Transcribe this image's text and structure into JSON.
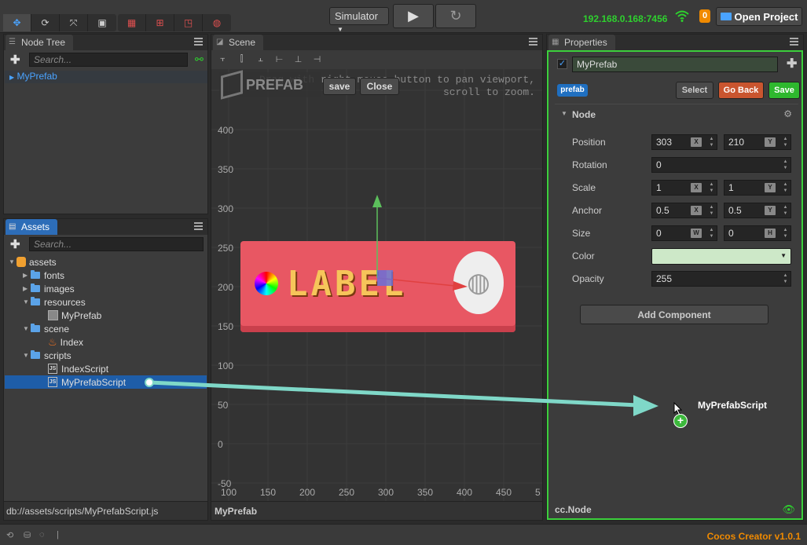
{
  "toolbar": {
    "transform_tools": [
      "move-tool-icon",
      "rotate-tool-icon",
      "scale-tool-icon",
      "rect-tool-icon"
    ],
    "gizmo_tools": [
      "pivot-icon",
      "global-icon",
      "flag-icon",
      "globe-icon"
    ],
    "simulator_label": "Simulator",
    "ip_address": "192.168.0.168:7456",
    "notification_count": "0",
    "open_project_label": "Open Project",
    "colors": {
      "ip": "#2ed12e",
      "badge": "#f08a00",
      "accent": "#4aa3ff"
    }
  },
  "node_tree": {
    "title": "Node Tree",
    "search_placeholder": "Search...",
    "root_node": "MyPrefab"
  },
  "assets": {
    "title": "Assets",
    "search_placeholder": "Search...",
    "items": [
      {
        "label": "assets",
        "kind": "root"
      },
      {
        "label": "fonts",
        "kind": "folder"
      },
      {
        "label": "images",
        "kind": "folder"
      },
      {
        "label": "resources",
        "kind": "folder"
      },
      {
        "label": "MyPrefab",
        "kind": "prefab"
      },
      {
        "label": "scene",
        "kind": "folder"
      },
      {
        "label": "Index",
        "kind": "fire"
      },
      {
        "label": "scripts",
        "kind": "folder"
      },
      {
        "label": "IndexScript",
        "kind": "js"
      },
      {
        "label": "MyPrefabScript",
        "kind": "js",
        "selected": true
      }
    ],
    "footer_path": "db://assets/scripts/MyPrefabScript.js"
  },
  "scene": {
    "title": "Scene",
    "hint_line1": "Drag with right mouse button to pan viewport,",
    "hint_line2": "scroll to zoom.",
    "hint_visible_line1": "Drag with right mouse button to pan viewport,",
    "prefab_mode_label": "PREFAB",
    "save_label": "save",
    "close_label": "Close",
    "y_ticks": [
      "400",
      "350",
      "300",
      "250",
      "200",
      "150",
      "100",
      "50",
      "0",
      "-50"
    ],
    "x_ticks": [
      "100",
      "150",
      "200",
      "250",
      "300",
      "350",
      "400",
      "450",
      "5"
    ],
    "label_text": "LABEL",
    "footer_name": "MyPrefab"
  },
  "properties": {
    "title": "Properties",
    "node_name": "MyPrefab",
    "prefab_tag": "prefab",
    "select_label": "Select",
    "go_back_label": "Go Back",
    "save_label": "Save",
    "section_title": "Node",
    "position_label": "Position",
    "position_x": "303",
    "position_y": "210",
    "rotation_label": "Rotation",
    "rotation": "0",
    "scale_label": "Scale",
    "scale_x": "1",
    "scale_y": "1",
    "anchor_label": "Anchor",
    "anchor_x": "0.5",
    "anchor_y": "0.5",
    "size_label": "Size",
    "size_w": "0",
    "size_h": "0",
    "color_label": "Color",
    "color_value": "#cde8c8",
    "opacity_label": "Opacity",
    "opacity": "255",
    "add_component_label": "Add Component",
    "footer_type": "cc.Node",
    "axis_x": "X",
    "axis_y": "Y",
    "axis_w": "W",
    "axis_h": "H",
    "colors": {
      "highlight_border": "#3ccf3c",
      "go_back": "#c9552f",
      "save": "#2eb82e"
    }
  },
  "drag": {
    "label": "MyPrefabScript"
  },
  "status": {
    "app_version": "Cocos Creator v1.0.1"
  }
}
